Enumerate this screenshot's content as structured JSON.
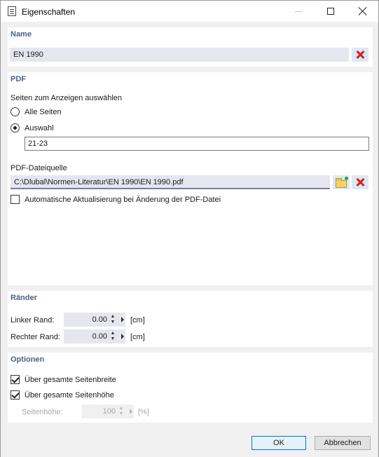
{
  "window": {
    "title": "Eigenschaften"
  },
  "name_section": {
    "title": "Name",
    "value": "EN 1990"
  },
  "pdf_section": {
    "title": "PDF",
    "pages_label": "Seiten zum Anzeigen auswählen",
    "option_all": "Alle Seiten",
    "option_selection": "Auswahl",
    "selected_option": "Auswahl",
    "pages_value": "21-23",
    "source_label": "PDF-Dateiquelle",
    "source_path": "C:\\Dlubal\\Normen-Literatur\\EN 1990\\EN 1990.pdf",
    "auto_update_label": "Automatische Aktualisierung bei Änderung der PDF-Datei",
    "auto_update_checked": false
  },
  "margins_section": {
    "title": "Ränder",
    "left_label": "Linker Rand:",
    "left_value": "0.00",
    "right_label": "Rechter Rand:",
    "right_value": "0.00",
    "unit": "[cm]"
  },
  "options_section": {
    "title": "Optionen",
    "full_width_label": "Über gesamte Seitenbreite",
    "full_width_checked": true,
    "full_height_label": "Über gesamte Seitenhöhe",
    "full_height_checked": true,
    "page_height_label": "Seitenhöhe:",
    "page_height_value": "100",
    "page_height_unit": "[%]"
  },
  "buttons": {
    "ok": "OK",
    "cancel": "Abbrechen"
  },
  "colors": {
    "section_title": "#4f6080",
    "delete_red": "#d81e1e",
    "ok_border": "#0078d7"
  }
}
